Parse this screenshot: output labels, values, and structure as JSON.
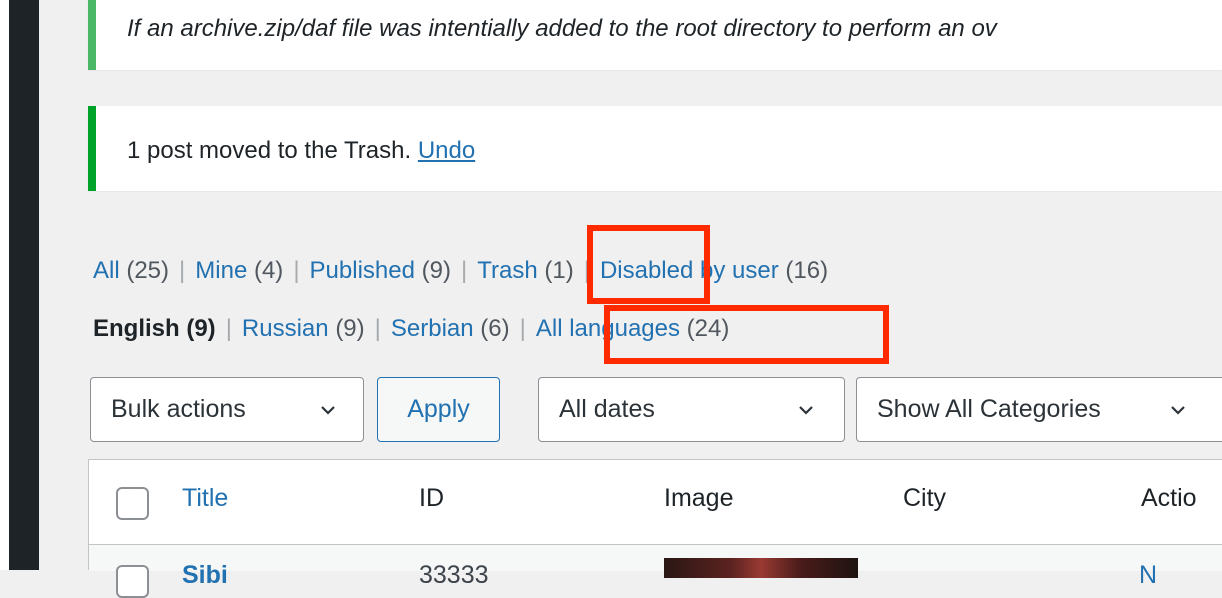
{
  "notices": {
    "archive_warning": "If an archive.zip/daf file was intentially added to the root directory to perform an ov",
    "trash_message": "1 post moved to the Trash.",
    "undo_label": "Undo"
  },
  "status_filters": [
    {
      "label": "All",
      "count": "(25)"
    },
    {
      "label": "Mine",
      "count": "(4)"
    },
    {
      "label": "Published",
      "count": "(9)"
    },
    {
      "label": "Trash",
      "count": "(1)"
    },
    {
      "label": "Disabled by user",
      "count": "(16)"
    }
  ],
  "language_filters": [
    {
      "label": "English",
      "count": "(9)",
      "current": true
    },
    {
      "label": "Russian",
      "count": "(9)"
    },
    {
      "label": "Serbian",
      "count": "(6)"
    },
    {
      "label": "All languages",
      "count": "(24)"
    }
  ],
  "toolbar": {
    "bulk_actions": "Bulk actions",
    "apply_label": "Apply",
    "dates": "All dates",
    "categories": "Show All Categories"
  },
  "table": {
    "columns": [
      "Title",
      "ID",
      "Image",
      "City",
      "Actio"
    ],
    "peek_row": {
      "title": "Sibi",
      "id": "33333",
      "action": "N"
    }
  },
  "colors": {
    "link": "#2271b1",
    "highlight": "#ff2a00",
    "notice_success": "#00a32a"
  }
}
